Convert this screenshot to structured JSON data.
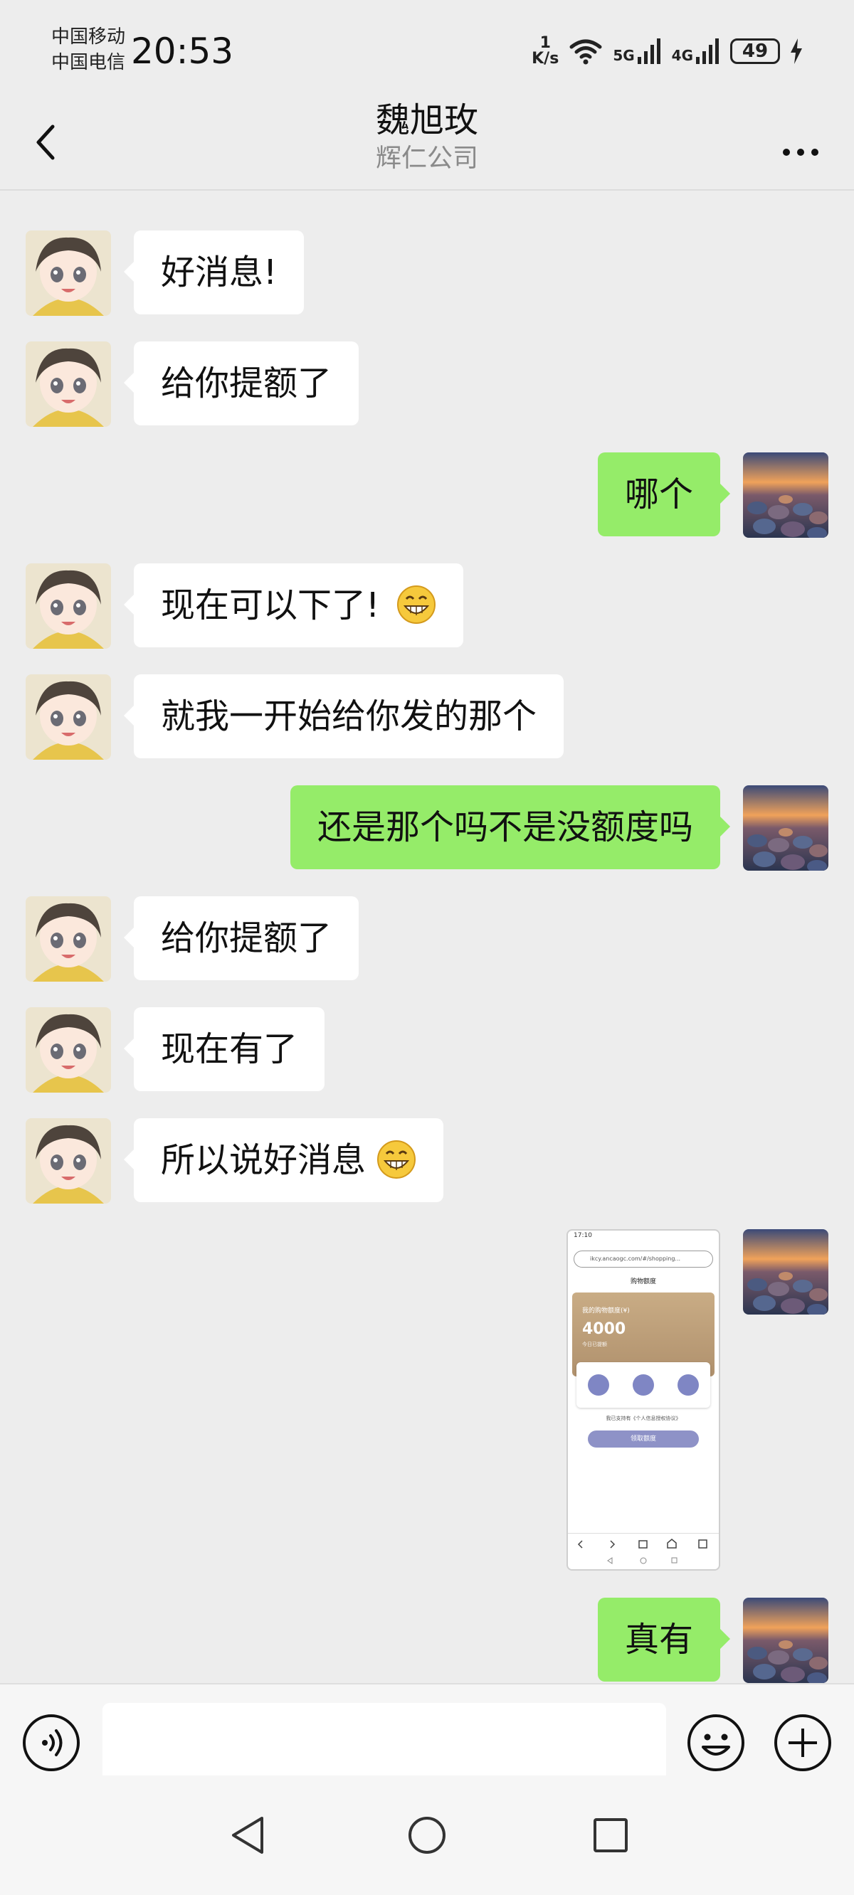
{
  "status": {
    "carrier1": "中国移动",
    "carrier2": "中国电信",
    "time": "20:53",
    "net_speed_value": "1",
    "net_speed_unit": "K/s",
    "net5g": "5G",
    "net4g": "4G",
    "battery": "49"
  },
  "header": {
    "title": "魏旭玫",
    "subtitle": "辉仁公司"
  },
  "messages": [
    {
      "side": "in",
      "text": "好消息!"
    },
    {
      "side": "in",
      "text": "给你提额了"
    },
    {
      "side": "out",
      "text": "哪个"
    },
    {
      "side": "in",
      "text": "现在可以下了!",
      "emoji": "grin-emoji"
    },
    {
      "side": "in",
      "text": "就我一开始给你发的那个"
    },
    {
      "side": "out",
      "text": "还是那个吗不是没额度吗"
    },
    {
      "side": "in",
      "text": "给你提额了"
    },
    {
      "side": "in",
      "text": "现在有了"
    },
    {
      "side": "in",
      "text": "所以说好消息",
      "emoji": "grin-emoji"
    },
    {
      "side": "out",
      "type": "image"
    },
    {
      "side": "out",
      "text": "真有"
    }
  ],
  "screenshot_thumb": {
    "status": "17:10",
    "url": "ikcy.ancaogc.com/#/shopping...",
    "title": "购物额度",
    "card_label": "我的购物额度(¥)",
    "amount": "4000",
    "card_sub": "今日已提额",
    "note": "我已支持有《个人信息授权协议》",
    "button": "领取额度"
  },
  "input": {
    "placeholder": ""
  },
  "colors": {
    "background": "#ededed",
    "incoming_bubble": "#ffffff",
    "outgoing_bubble": "#95ec69"
  }
}
